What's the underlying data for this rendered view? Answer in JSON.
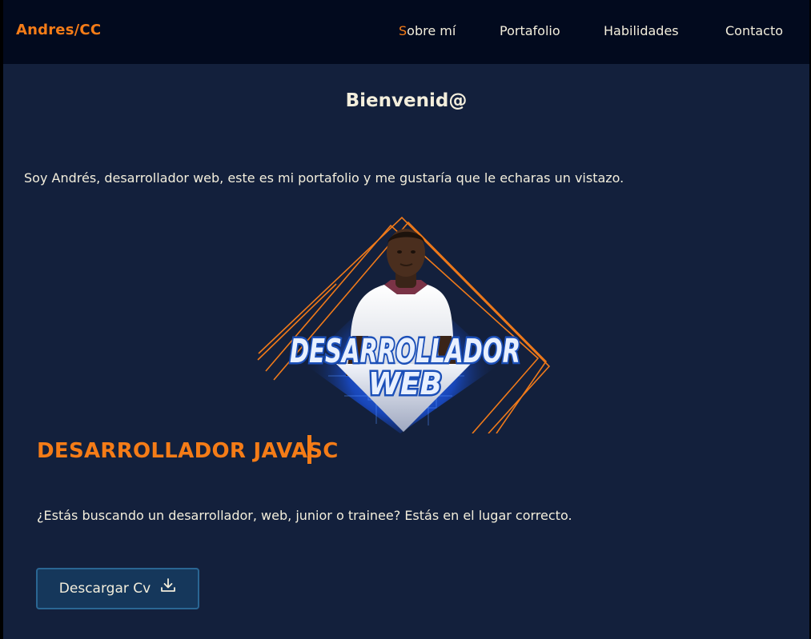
{
  "header": {
    "logo": "Andres/CC",
    "nav": [
      {
        "first": "S",
        "rest": "obre mí"
      },
      {
        "label": "Portafolio"
      },
      {
        "label": "Habilidades"
      },
      {
        "label": "Contacto"
      }
    ]
  },
  "main": {
    "welcome": "Bienvenid@",
    "intro": "Soy Andrés, desarrollador web, este es mi portafolio y me gustaría que le echaras un vistazo.",
    "hero_line1": "DESARROLLADOR",
    "hero_line2": "WEB",
    "typed_role": "DESARROLLADOR JAVASC",
    "question": "¿Estás buscando un desarrollador, web, junior o trainee? Estás en el lugar correcto.",
    "download_label": "Descargar Cv",
    "download_icon": "download-icon"
  },
  "colors": {
    "background": "#13203c",
    "navbar": "#020a1e",
    "accent": "#f57c17",
    "text": "#f3eedc",
    "button": "#15375b"
  }
}
